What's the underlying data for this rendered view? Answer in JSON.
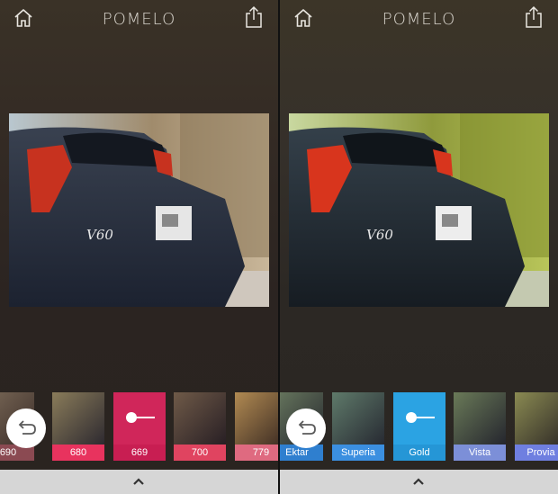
{
  "app": {
    "title": "POMELO"
  },
  "left": {
    "title": "POMELO",
    "filters": [
      {
        "label": "690",
        "color": "#8b4a52"
      },
      {
        "label": "680",
        "color": "#e8335e"
      },
      {
        "label": "669",
        "color": "#d0265a"
      },
      {
        "label": "700",
        "color": "#e04460"
      },
      {
        "label": "779",
        "color": "#df6a80"
      }
    ],
    "selected_filter": "669"
  },
  "right": {
    "title": "POMELO",
    "filters": [
      {
        "label": "Ektar",
        "color": "#2f7fcf"
      },
      {
        "label": "Superia",
        "color": "#3b8fe0"
      },
      {
        "label": "Gold",
        "color": "#2ba3e3"
      },
      {
        "label": "Vista",
        "color": "#7c8fd8"
      },
      {
        "label": "Provia",
        "color": "#6f7fe0"
      }
    ],
    "selected_filter": "Gold"
  },
  "icons": {
    "home": "home-icon",
    "share": "share-icon",
    "undo": "undo-icon",
    "slider": "slider-icon",
    "chevron": "chevron-up-icon"
  },
  "photo": {
    "badge": "V60"
  }
}
